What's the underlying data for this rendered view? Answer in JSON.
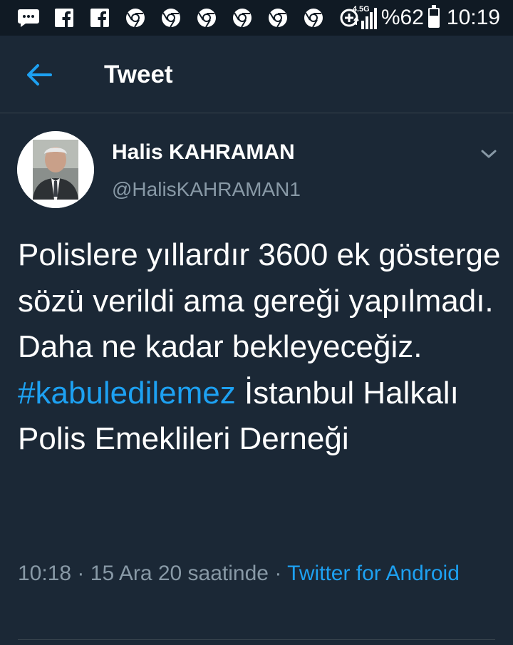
{
  "status_bar": {
    "network_label": "4.5G",
    "battery_percent": "%62",
    "battery_level": 0.62,
    "time": "10:19",
    "notification_icons": [
      "messages-icon",
      "facebook-icon",
      "facebook-icon",
      "chrome-icon",
      "chrome-icon",
      "chrome-icon",
      "chrome-icon",
      "chrome-icon",
      "chrome-icon",
      "data-saver-icon"
    ]
  },
  "app_bar": {
    "title": "Tweet",
    "back_icon": "arrow-left-icon"
  },
  "tweet": {
    "display_name": "Halis KAHRAMAN",
    "handle": "@HalisKAHRAMAN1",
    "text_plain": "Polislere yıllardır 3600 ek gösterge sözü verildi ama gereği yapılmadı. Daha ne kadar bekleyeceğiz.",
    "hashtag": "#kabuledilemez",
    "text_after": "İstanbul Halkalı Polis Emeklileri Derneği",
    "time": "10:18",
    "separator": "·",
    "date": "15 Ara 20 saatinde",
    "source": "Twitter for Android"
  },
  "colors": {
    "background": "#1b2836",
    "status_bar": "#101a24",
    "accent": "#1da1f2",
    "secondary_text": "#8899a6",
    "divider": "#38444d"
  }
}
